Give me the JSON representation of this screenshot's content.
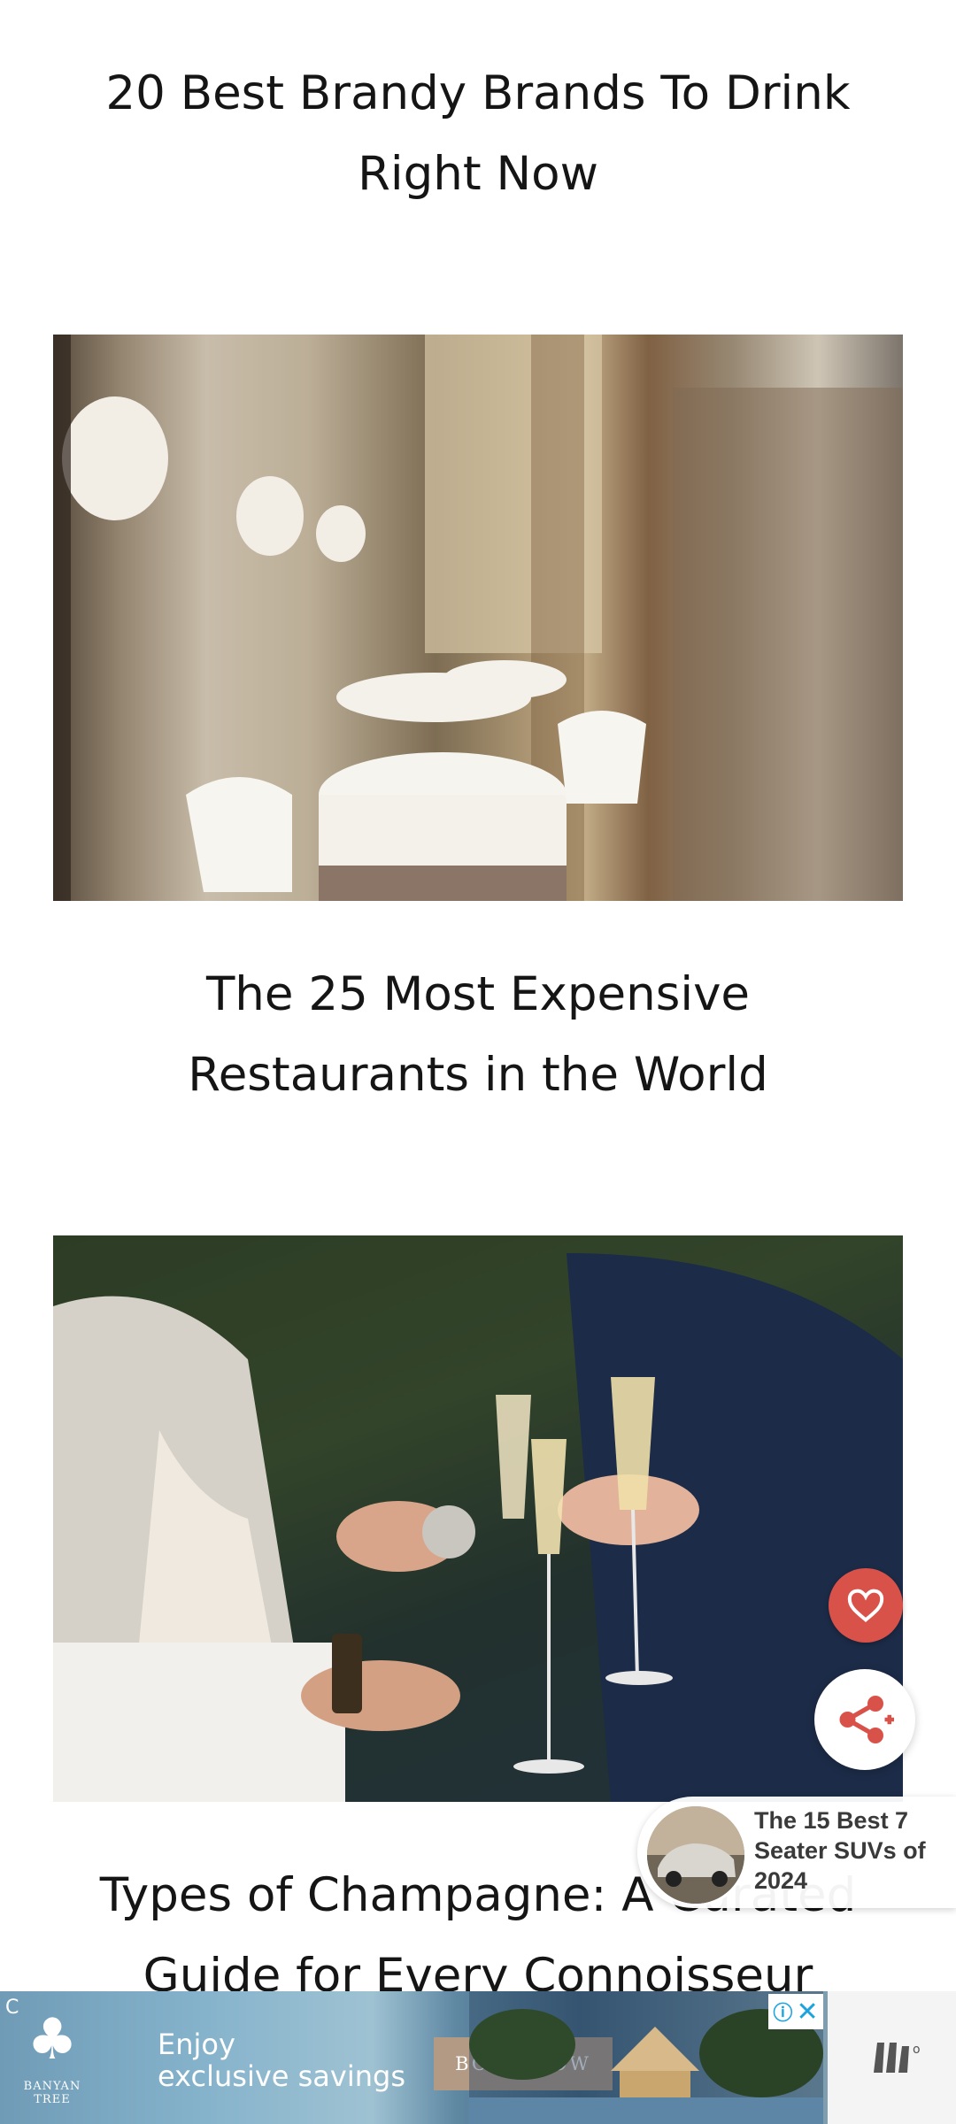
{
  "articles": [
    {
      "title_line1": "20 Best Brandy Brands To Drink",
      "title_line2": "Right Now"
    },
    {
      "title_line1": "The 25 Most Expensive",
      "title_line2": "Restaurants in the World"
    },
    {
      "title_line1": "Types of Champagne: A Curated",
      "title_line2": "Guide for Every Connoisseur"
    }
  ],
  "floating": {
    "favorite_icon": "heart-icon",
    "share_icon": "share-icon",
    "accent_color": "#d9524a"
  },
  "related": {
    "text": "The 15 Best 7 Seater SUVs of 2024"
  },
  "ad": {
    "brand": "BANYAN TREE",
    "headline_line1": "Enjoy",
    "headline_line2": "exclusive savings",
    "cta": "BOOK NOW",
    "corner_mark": "C"
  }
}
